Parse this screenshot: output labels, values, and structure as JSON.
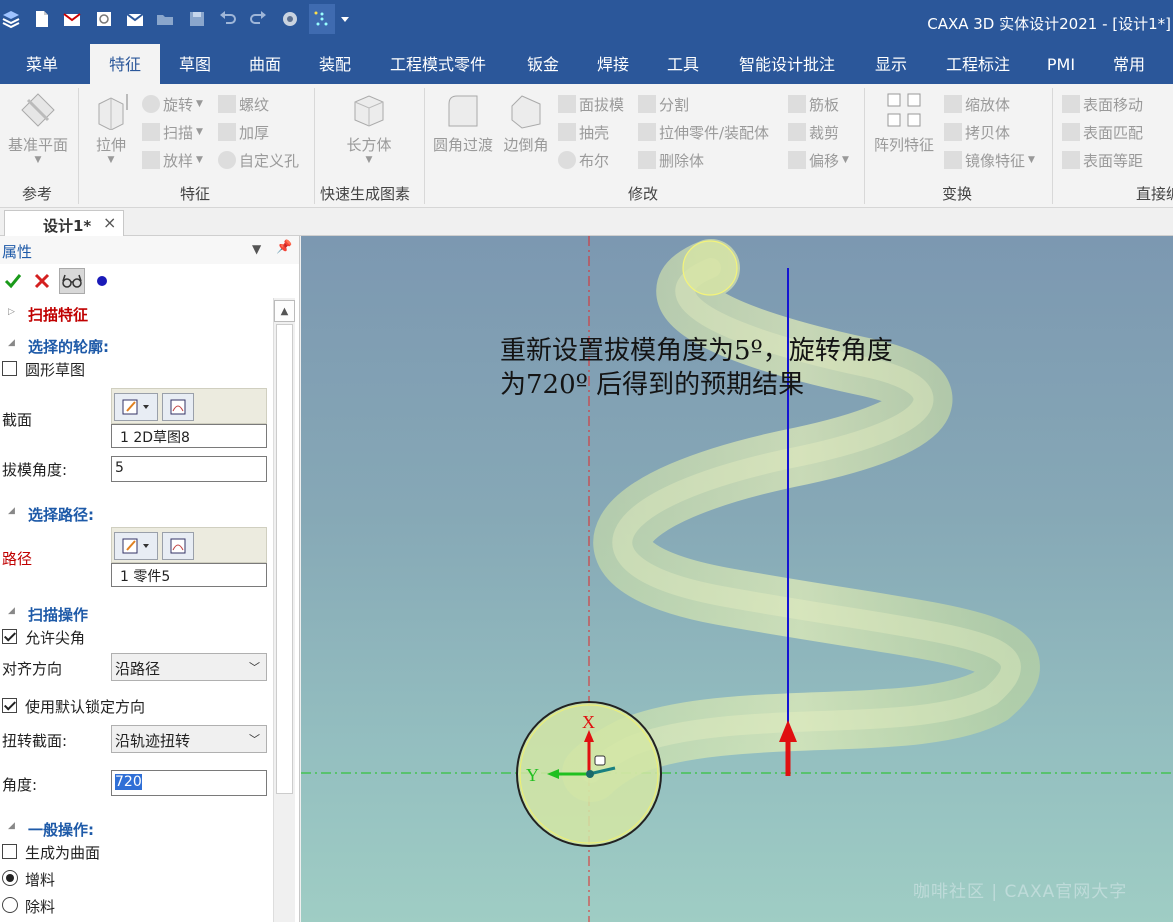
{
  "app": {
    "title": "CAXA 3D 实体设计2021 - [设计1*]",
    "quick_access_icons": [
      "caxa-logo-icon",
      "new-file-icon",
      "open-file-icon",
      "print-icon",
      "save-mail-icon",
      "folder-icon",
      "save-icon",
      "undo-icon",
      "redo-icon",
      "render-icon",
      "design-env-icon",
      "customize-dropdown-icon"
    ]
  },
  "tabs": [
    {
      "label": "菜单"
    },
    {
      "label": "特征"
    },
    {
      "label": "草图"
    },
    {
      "label": "曲面"
    },
    {
      "label": "装配"
    },
    {
      "label": "工程模式零件"
    },
    {
      "label": "钣金"
    },
    {
      "label": "焊接"
    },
    {
      "label": "工具"
    },
    {
      "label": "智能设计批注"
    },
    {
      "label": "显示"
    },
    {
      "label": "工程标注"
    },
    {
      "label": "PMI"
    },
    {
      "label": "常用"
    }
  ],
  "ribbon": {
    "groups": {
      "reference": "参考",
      "feature": "特征",
      "quick_gen": "快速生成图素",
      "modify": "修改",
      "transform": "变换",
      "direct": "直接编"
    },
    "buttons": {
      "datum_plane": "基准平面",
      "extrude": "拉伸",
      "revolve": "旋转",
      "sweep": "扫描",
      "loft": "放样",
      "thread": "螺纹",
      "thicken": "加厚",
      "custom_hole": "自定义孔",
      "box": "长方体",
      "fillet": "圆角过渡",
      "chamfer": "边倒角",
      "draft": "面拔模",
      "shell": "抽壳",
      "boolean": "布尔",
      "split": "分割",
      "stretch": "拉伸零件/装配体",
      "delete_body": "删除体",
      "rib": "筋板",
      "trim": "裁剪",
      "offset": "偏移",
      "pattern": "阵列特征",
      "scale": "缩放体",
      "copy": "拷贝体",
      "mirror": "镜像特征",
      "face_move": "表面移动",
      "face_match": "表面匹配",
      "face_equidistant": "表面等距"
    }
  },
  "document_tab": {
    "label": "设计1*",
    "close": "×"
  },
  "properties": {
    "title": "属性",
    "feature_title": "扫描特征",
    "profile_section": "选择的轮廓:",
    "circular_sketch_label": "圆形草图",
    "circular_sketch_checked": false,
    "section_label": "截面",
    "section_value": "1   2D草图8",
    "draft_angle_label": "拔模角度:",
    "draft_angle_value": "5",
    "path_section": "选择路径:",
    "path_label": "路径",
    "path_value": "1   零件5",
    "sweep_ops_section": "扫描操作",
    "allow_sharp_label": "允许尖角",
    "allow_sharp_checked": true,
    "align_label": "对齐方向",
    "align_value": "沿路径",
    "default_lock_label": "使用默认锁定方向",
    "default_lock_checked": true,
    "twist_label": "扭转截面:",
    "twist_value": "沿轨迹扭转",
    "angle_label": "角度:",
    "angle_value": "720",
    "general_ops_section": "一般操作:",
    "surface_label": "生成为曲面",
    "surface_checked": false,
    "add_label": "增料",
    "add_selected": true,
    "remove_label": "除料",
    "remove_selected": false
  },
  "viewport": {
    "annotation_line1": "重新设置拔模角度为5º，旋转角度",
    "annotation_line2": "为720º 后得到的预期结果",
    "axis_x_label": "X",
    "axis_y_label": "Y",
    "watermark": "咖啡社区 | CAXA官网大字",
    "colors": {
      "helix_fill": "#d8e8a0",
      "profile_fill": "#d4e6a4",
      "path_axis": "#1414d2",
      "x_axis": "#e01010",
      "y_axis": "#20c020"
    }
  }
}
